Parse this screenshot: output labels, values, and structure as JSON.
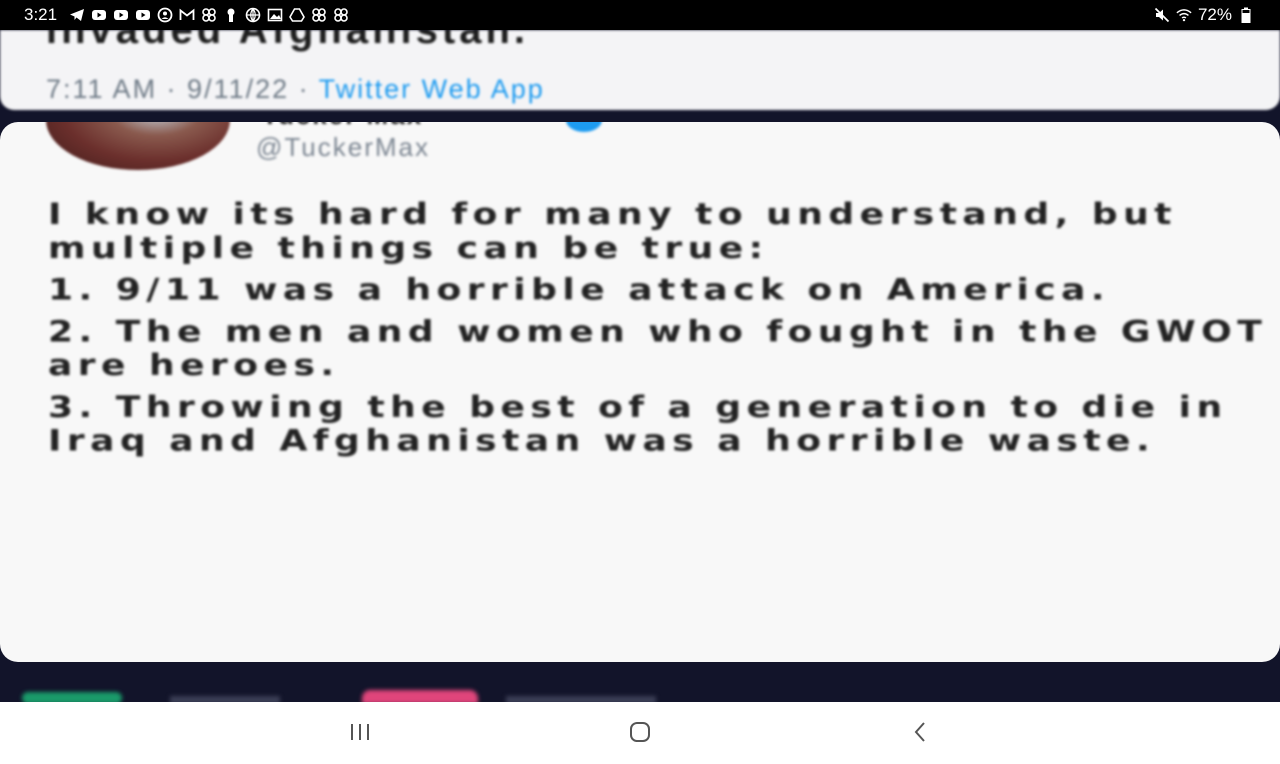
{
  "status_bar": {
    "time": "3:21",
    "left_icons": [
      "telegram-icon",
      "youtube-icon",
      "youtube-icon",
      "youtube-icon",
      "privacy-icon",
      "gmail-icon",
      "pinwheel-icon",
      "keyhole-icon",
      "globe-icon",
      "gallery-icon",
      "drive-icon",
      "pinwheel-icon",
      "pinwheel-icon"
    ],
    "right_icons": [
      "mute-icon",
      "wifi-icon",
      "battery-icon"
    ],
    "battery": "72%"
  },
  "tweet_top": {
    "clipped_text": "invaded Afghanistan.",
    "meta_time": "7:11 AM · 9/11/22 · ",
    "meta_app": "Twitter Web App"
  },
  "tweet_main": {
    "author_name": "Tucker Max",
    "handle": "@TuckerMax",
    "paragraphs": [
      "I know its hard for many to understand, but multiple things can be true:",
      "1. 9/11 was a horrible attack on America.",
      "2. The men and women who fought in the GWOT are heroes.",
      "3. Throwing the best of a generation to die in Iraq and Afghanistan was a horrible waste."
    ]
  },
  "colors": {
    "accent": "#1d9bf0",
    "retweet": "#1a9a6a",
    "like": "#e0457b",
    "background_dark": "#12142a"
  },
  "nav_bar": {
    "recents_icon": "recents-icon",
    "home_icon": "home-icon",
    "back_icon": "back-icon"
  }
}
